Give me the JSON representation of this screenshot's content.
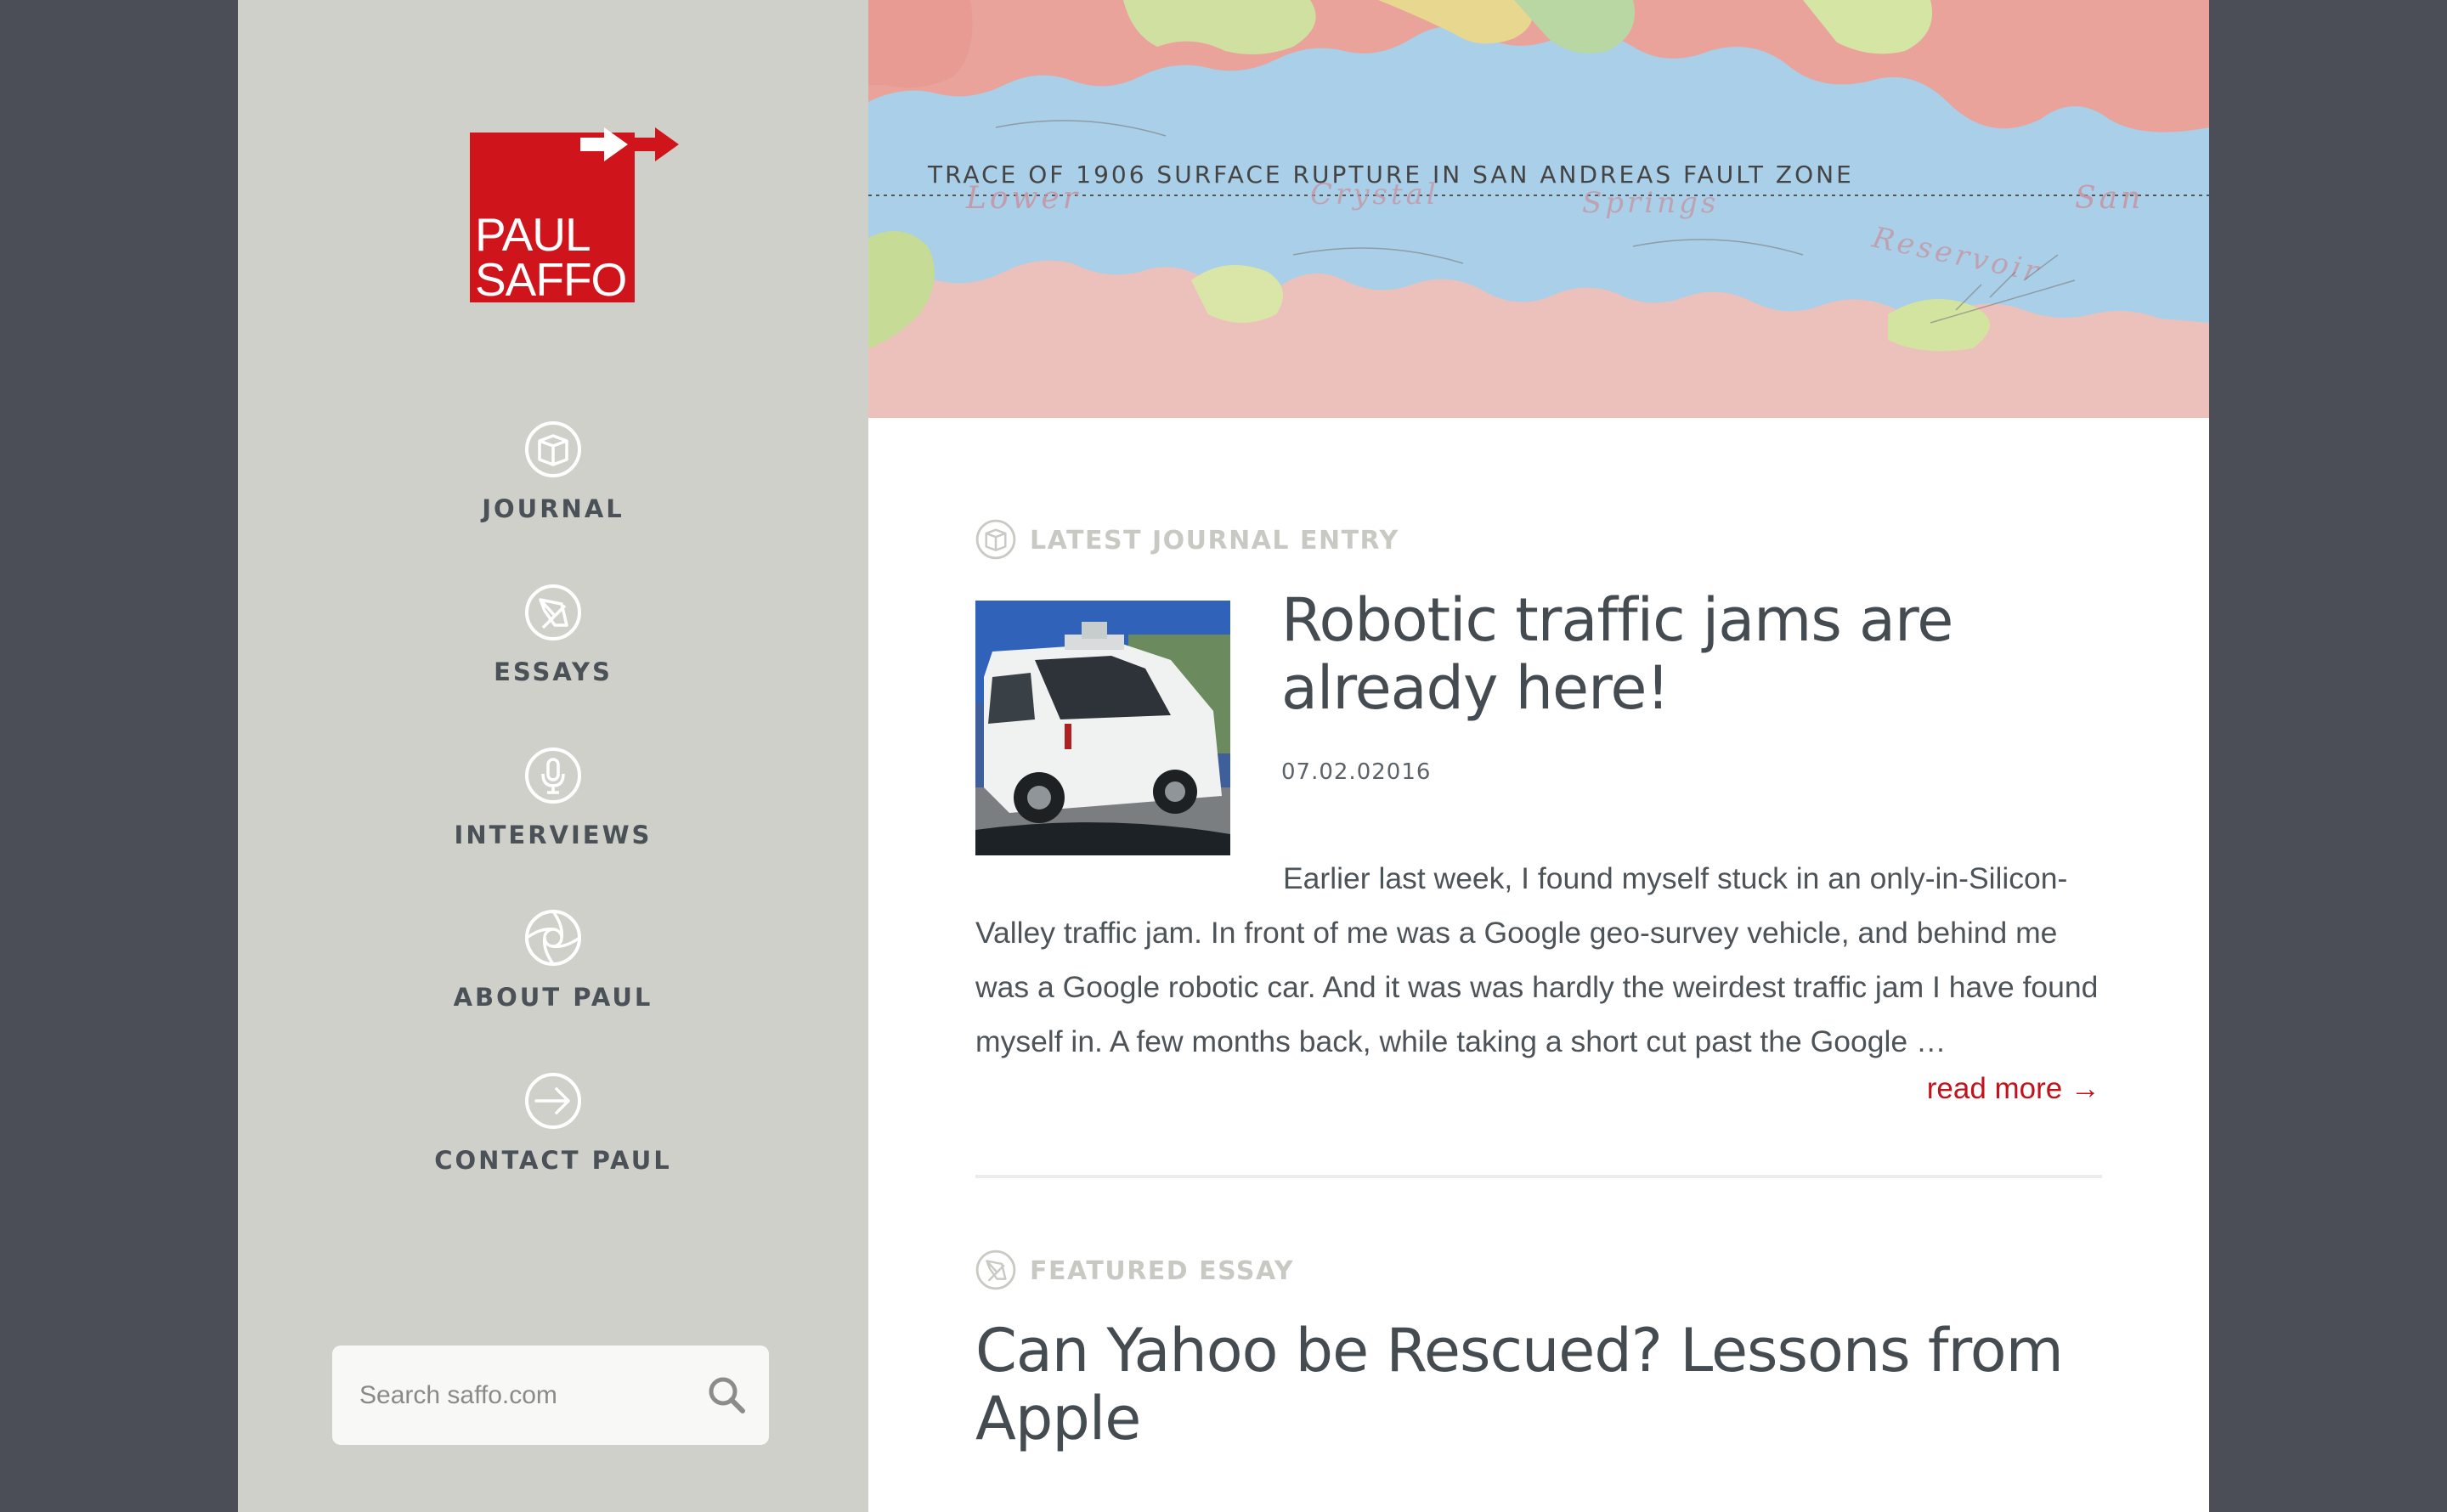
{
  "brand": {
    "line1": "PAUL",
    "line2": "SAFFO",
    "color": "#d0141b"
  },
  "nav": {
    "items": [
      {
        "label": "JOURNAL",
        "icon": "book-icon"
      },
      {
        "label": "ESSAYS",
        "icon": "pen-nib-icon"
      },
      {
        "label": "INTERVIEWS",
        "icon": "microphone-icon"
      },
      {
        "label": "ABOUT PAUL",
        "icon": "aperture-icon"
      },
      {
        "label": "CONTACT PAUL",
        "icon": "arrow-right-circle-icon"
      }
    ]
  },
  "search": {
    "placeholder": "Search saffo.com",
    "icon": "search-icon"
  },
  "hero": {
    "map_lines": [
      "TRACE OF 1906 SURFACE RUPTURE IN SAN ANDREAS FAULT ZONE",
      "Lower",
      "Crystal",
      "Springs",
      "Reservoir",
      "San"
    ]
  },
  "journal": {
    "section_label": "LATEST JOURNAL ENTRY",
    "title": "Robotic traffic jams are already here!",
    "date": "07.02.02016",
    "excerpt": "Earlier last week, I found myself stuck in an only-in-Silicon-Valley traffic jam.  In front of me was a Google geo-survey vehicle, and behind me was a Google robotic car.  And it was was hardly the weirdest traffic jam I have found myself in. A few months back, while taking a short cut past the Google …",
    "read_more": "read more →"
  },
  "essay": {
    "section_label": "FEATURED ESSAY",
    "title": "Can Yahoo be Rescued? Lessons from Apple"
  },
  "colors": {
    "accent": "#c0131b",
    "sidebar_bg": "#d0d0cb",
    "page_bg": "#4b4e56",
    "text": "#444b51"
  }
}
